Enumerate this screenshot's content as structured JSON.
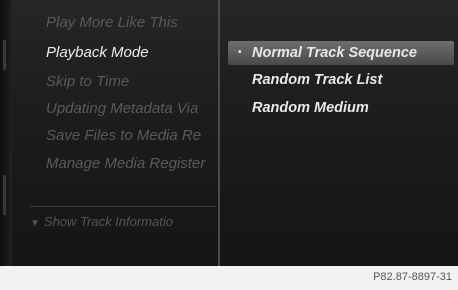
{
  "left_menu": {
    "items": [
      {
        "label": "Play More Like This",
        "active": false
      },
      {
        "label": "Playback Mode",
        "active": true
      },
      {
        "label": "Skip to Time",
        "active": false
      },
      {
        "label": "Updating Metadata Via",
        "active": false
      },
      {
        "label": "Save Files to Media Re",
        "active": false
      },
      {
        "label": "Manage Media Register",
        "active": false
      }
    ],
    "footer_label": "Show Track Informatio"
  },
  "right_panel": {
    "options": [
      {
        "label": "Normal Track Sequence",
        "selected": true,
        "bullet": "•"
      },
      {
        "label": "Random Track List",
        "selected": false,
        "bullet": ""
      },
      {
        "label": "Random Medium",
        "selected": false,
        "bullet": ""
      }
    ]
  },
  "footer": {
    "code": "P82.87-8897-31"
  }
}
